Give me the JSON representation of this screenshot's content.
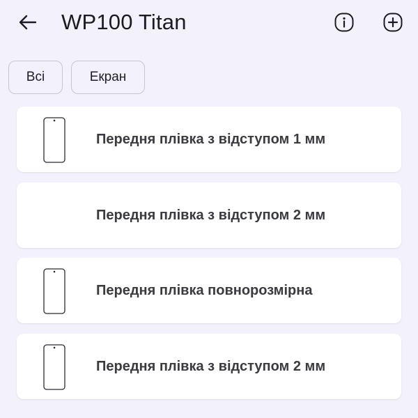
{
  "header": {
    "title": "WP100 Titan",
    "back_icon": "arrow-left-icon",
    "info_icon": "info-icon",
    "add_icon": "plus-circle-icon"
  },
  "filters": [
    {
      "label": "Всі"
    },
    {
      "label": "Екран"
    }
  ],
  "items": [
    {
      "label": "Передня плівка з відступом 1 мм",
      "icon": "phone-outline-icon"
    },
    {
      "label": "Передня плівка з відступом 2 мм",
      "icon": ""
    },
    {
      "label": "Передня плівка повнорозмірна",
      "icon": "phone-outline-icon"
    },
    {
      "label": "Передня плівка з відступом 2 мм",
      "icon": "phone-outline-icon"
    }
  ],
  "colors": {
    "background": "#f3f1fb",
    "card": "#ffffff",
    "text": "#3b3a40",
    "chip_border": "#c9c5cf"
  }
}
